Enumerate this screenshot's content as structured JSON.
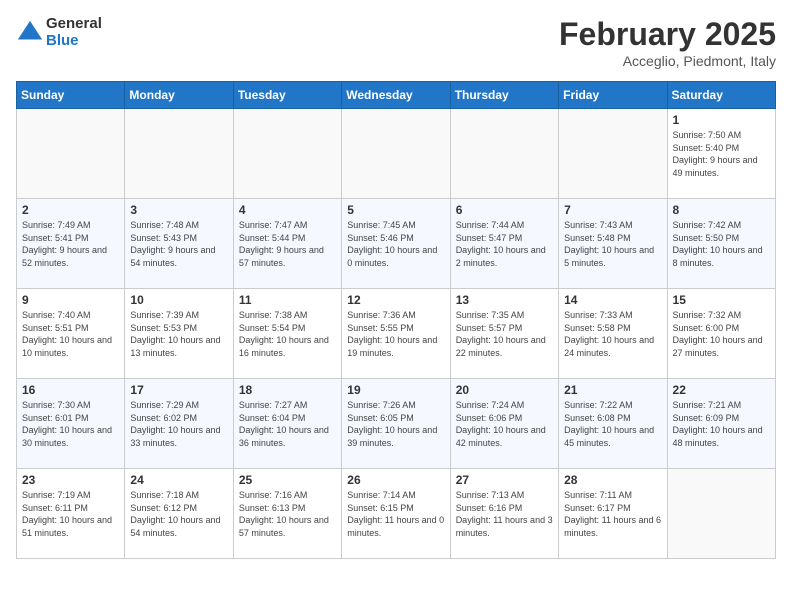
{
  "header": {
    "logo_general": "General",
    "logo_blue": "Blue",
    "title": "February 2025",
    "subtitle": "Acceglio, Piedmont, Italy"
  },
  "weekdays": [
    "Sunday",
    "Monday",
    "Tuesday",
    "Wednesday",
    "Thursday",
    "Friday",
    "Saturday"
  ],
  "weeks": [
    [
      {
        "day": "",
        "info": ""
      },
      {
        "day": "",
        "info": ""
      },
      {
        "day": "",
        "info": ""
      },
      {
        "day": "",
        "info": ""
      },
      {
        "day": "",
        "info": ""
      },
      {
        "day": "",
        "info": ""
      },
      {
        "day": "1",
        "info": "Sunrise: 7:50 AM\nSunset: 5:40 PM\nDaylight: 9 hours and 49 minutes."
      }
    ],
    [
      {
        "day": "2",
        "info": "Sunrise: 7:49 AM\nSunset: 5:41 PM\nDaylight: 9 hours and 52 minutes."
      },
      {
        "day": "3",
        "info": "Sunrise: 7:48 AM\nSunset: 5:43 PM\nDaylight: 9 hours and 54 minutes."
      },
      {
        "day": "4",
        "info": "Sunrise: 7:47 AM\nSunset: 5:44 PM\nDaylight: 9 hours and 57 minutes."
      },
      {
        "day": "5",
        "info": "Sunrise: 7:45 AM\nSunset: 5:46 PM\nDaylight: 10 hours and 0 minutes."
      },
      {
        "day": "6",
        "info": "Sunrise: 7:44 AM\nSunset: 5:47 PM\nDaylight: 10 hours and 2 minutes."
      },
      {
        "day": "7",
        "info": "Sunrise: 7:43 AM\nSunset: 5:48 PM\nDaylight: 10 hours and 5 minutes."
      },
      {
        "day": "8",
        "info": "Sunrise: 7:42 AM\nSunset: 5:50 PM\nDaylight: 10 hours and 8 minutes."
      }
    ],
    [
      {
        "day": "9",
        "info": "Sunrise: 7:40 AM\nSunset: 5:51 PM\nDaylight: 10 hours and 10 minutes."
      },
      {
        "day": "10",
        "info": "Sunrise: 7:39 AM\nSunset: 5:53 PM\nDaylight: 10 hours and 13 minutes."
      },
      {
        "day": "11",
        "info": "Sunrise: 7:38 AM\nSunset: 5:54 PM\nDaylight: 10 hours and 16 minutes."
      },
      {
        "day": "12",
        "info": "Sunrise: 7:36 AM\nSunset: 5:55 PM\nDaylight: 10 hours and 19 minutes."
      },
      {
        "day": "13",
        "info": "Sunrise: 7:35 AM\nSunset: 5:57 PM\nDaylight: 10 hours and 22 minutes."
      },
      {
        "day": "14",
        "info": "Sunrise: 7:33 AM\nSunset: 5:58 PM\nDaylight: 10 hours and 24 minutes."
      },
      {
        "day": "15",
        "info": "Sunrise: 7:32 AM\nSunset: 6:00 PM\nDaylight: 10 hours and 27 minutes."
      }
    ],
    [
      {
        "day": "16",
        "info": "Sunrise: 7:30 AM\nSunset: 6:01 PM\nDaylight: 10 hours and 30 minutes."
      },
      {
        "day": "17",
        "info": "Sunrise: 7:29 AM\nSunset: 6:02 PM\nDaylight: 10 hours and 33 minutes."
      },
      {
        "day": "18",
        "info": "Sunrise: 7:27 AM\nSunset: 6:04 PM\nDaylight: 10 hours and 36 minutes."
      },
      {
        "day": "19",
        "info": "Sunrise: 7:26 AM\nSunset: 6:05 PM\nDaylight: 10 hours and 39 minutes."
      },
      {
        "day": "20",
        "info": "Sunrise: 7:24 AM\nSunset: 6:06 PM\nDaylight: 10 hours and 42 minutes."
      },
      {
        "day": "21",
        "info": "Sunrise: 7:22 AM\nSunset: 6:08 PM\nDaylight: 10 hours and 45 minutes."
      },
      {
        "day": "22",
        "info": "Sunrise: 7:21 AM\nSunset: 6:09 PM\nDaylight: 10 hours and 48 minutes."
      }
    ],
    [
      {
        "day": "23",
        "info": "Sunrise: 7:19 AM\nSunset: 6:11 PM\nDaylight: 10 hours and 51 minutes."
      },
      {
        "day": "24",
        "info": "Sunrise: 7:18 AM\nSunset: 6:12 PM\nDaylight: 10 hours and 54 minutes."
      },
      {
        "day": "25",
        "info": "Sunrise: 7:16 AM\nSunset: 6:13 PM\nDaylight: 10 hours and 57 minutes."
      },
      {
        "day": "26",
        "info": "Sunrise: 7:14 AM\nSunset: 6:15 PM\nDaylight: 11 hours and 0 minutes."
      },
      {
        "day": "27",
        "info": "Sunrise: 7:13 AM\nSunset: 6:16 PM\nDaylight: 11 hours and 3 minutes."
      },
      {
        "day": "28",
        "info": "Sunrise: 7:11 AM\nSunset: 6:17 PM\nDaylight: 11 hours and 6 minutes."
      },
      {
        "day": "",
        "info": ""
      }
    ]
  ]
}
